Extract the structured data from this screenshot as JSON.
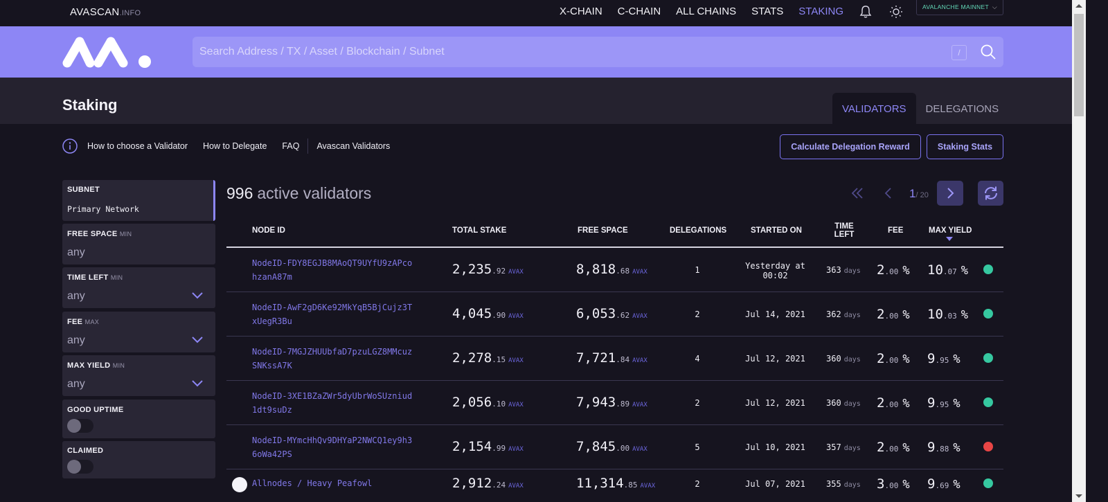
{
  "brand": {
    "name": "AVASCAN",
    "suffix": ".INFO"
  },
  "nav": {
    "links": [
      "X-CHAIN",
      "C-CHAIN",
      "ALL CHAINS",
      "STATS",
      "STAKING"
    ],
    "active": "STAKING",
    "network": "AVALANCHE MAINNET"
  },
  "search": {
    "placeholder": "Search Address / TX / Asset / Blockchain / Subnet",
    "shortcut": "/"
  },
  "page": {
    "title": "Staking",
    "tabs": [
      "VALIDATORS",
      "DELEGATIONS"
    ],
    "active_tab": "VALIDATORS"
  },
  "help": {
    "links": [
      "How to choose a Validator",
      "How to Delegate",
      "FAQ",
      "Avascan Validators"
    ],
    "buttons": {
      "calc": "Calculate Delegation Reward",
      "stats": "Staking Stats"
    }
  },
  "filters": {
    "subnet": {
      "label": "SUBNET",
      "value": "Primary Network"
    },
    "free_space": {
      "label": "FREE SPACE",
      "qualifier": "MIN",
      "value": "any"
    },
    "time_left": {
      "label": "TIME LEFT",
      "qualifier": "MIN",
      "value": "any"
    },
    "fee": {
      "label": "FEE",
      "qualifier": "MAX",
      "value": "any"
    },
    "max_yield": {
      "label": "MAX YIELD",
      "qualifier": "MIN",
      "value": "any"
    },
    "good_uptime": {
      "label": "GOOD UPTIME",
      "on": false
    },
    "claimed": {
      "label": "CLAIMED",
      "on": false
    }
  },
  "summary": {
    "count": "996",
    "label": "active validators",
    "page": "1",
    "total_pages": "/ 20"
  },
  "table": {
    "headers": {
      "node": "NODE ID",
      "stake": "TOTAL STAKE",
      "free": "FREE SPACE",
      "delegations": "DELEGATIONS",
      "started": "STARTED ON",
      "time_left": "TIME LEFT",
      "fee": "FEE",
      "yield": "MAX YIELD"
    },
    "unit": "AVAX",
    "days_label": "days",
    "pct": "%",
    "status_colors": {
      "good": "#36c8a0",
      "bad": "#e84545"
    },
    "rows": [
      {
        "node": "NodeID-FDY8EGJB8MAoQT9UYfU9zAPcohzanA87m",
        "stake_int": "2,235",
        "stake_dec": ".92",
        "free_int": "8,818",
        "free_dec": ".68",
        "delegations": "1",
        "started": "Yesterday at 00:02",
        "days": "363",
        "fee_int": "2",
        "fee_dec": ".00",
        "yield_int": "10",
        "yield_dec": ".07",
        "status": "good",
        "avatar": false
      },
      {
        "node": "NodeID-AwF2gD6Ke92MkYqB5BjCujz3TxUegR3Bu",
        "stake_int": "4,045",
        "stake_dec": ".90",
        "free_int": "6,053",
        "free_dec": ".62",
        "delegations": "2",
        "started": "Jul 14, 2021",
        "days": "362",
        "fee_int": "2",
        "fee_dec": ".00",
        "yield_int": "10",
        "yield_dec": ".03",
        "status": "good",
        "avatar": false
      },
      {
        "node": "NodeID-7MGJZHUUbfaD7pzuLGZ8MMcuzSNKssA7K",
        "stake_int": "2,278",
        "stake_dec": ".15",
        "free_int": "7,721",
        "free_dec": ".84",
        "delegations": "4",
        "started": "Jul 12, 2021",
        "days": "360",
        "fee_int": "2",
        "fee_dec": ".00",
        "yield_int": "9",
        "yield_dec": ".95",
        "status": "good",
        "avatar": false
      },
      {
        "node": "NodeID-3XE1BZaZWr5dyUbrWoSUzniud1dt9suDz",
        "stake_int": "2,056",
        "stake_dec": ".10",
        "free_int": "7,943",
        "free_dec": ".89",
        "delegations": "2",
        "started": "Jul 12, 2021",
        "days": "360",
        "fee_int": "2",
        "fee_dec": ".00",
        "yield_int": "9",
        "yield_dec": ".95",
        "status": "good",
        "avatar": false
      },
      {
        "node": "NodeID-MYmcHhQv9DHYaP2NWCQ1ey9h36oWa42PS",
        "stake_int": "2,154",
        "stake_dec": ".99",
        "free_int": "7,845",
        "free_dec": ".00",
        "delegations": "5",
        "started": "Jul 10, 2021",
        "days": "357",
        "fee_int": "2",
        "fee_dec": ".00",
        "yield_int": "9",
        "yield_dec": ".88",
        "status": "bad",
        "avatar": false
      },
      {
        "node": "Allnodes / Heavy Peafowl",
        "stake_int": "2,912",
        "stake_dec": ".24",
        "free_int": "11,314",
        "free_dec": ".85",
        "delegations": "2",
        "started": "Jul 07, 2021",
        "days": "355",
        "fee_int": "3",
        "fee_dec": ".00",
        "yield_int": "9",
        "yield_dec": ".69",
        "status": "good",
        "avatar": true
      }
    ]
  }
}
